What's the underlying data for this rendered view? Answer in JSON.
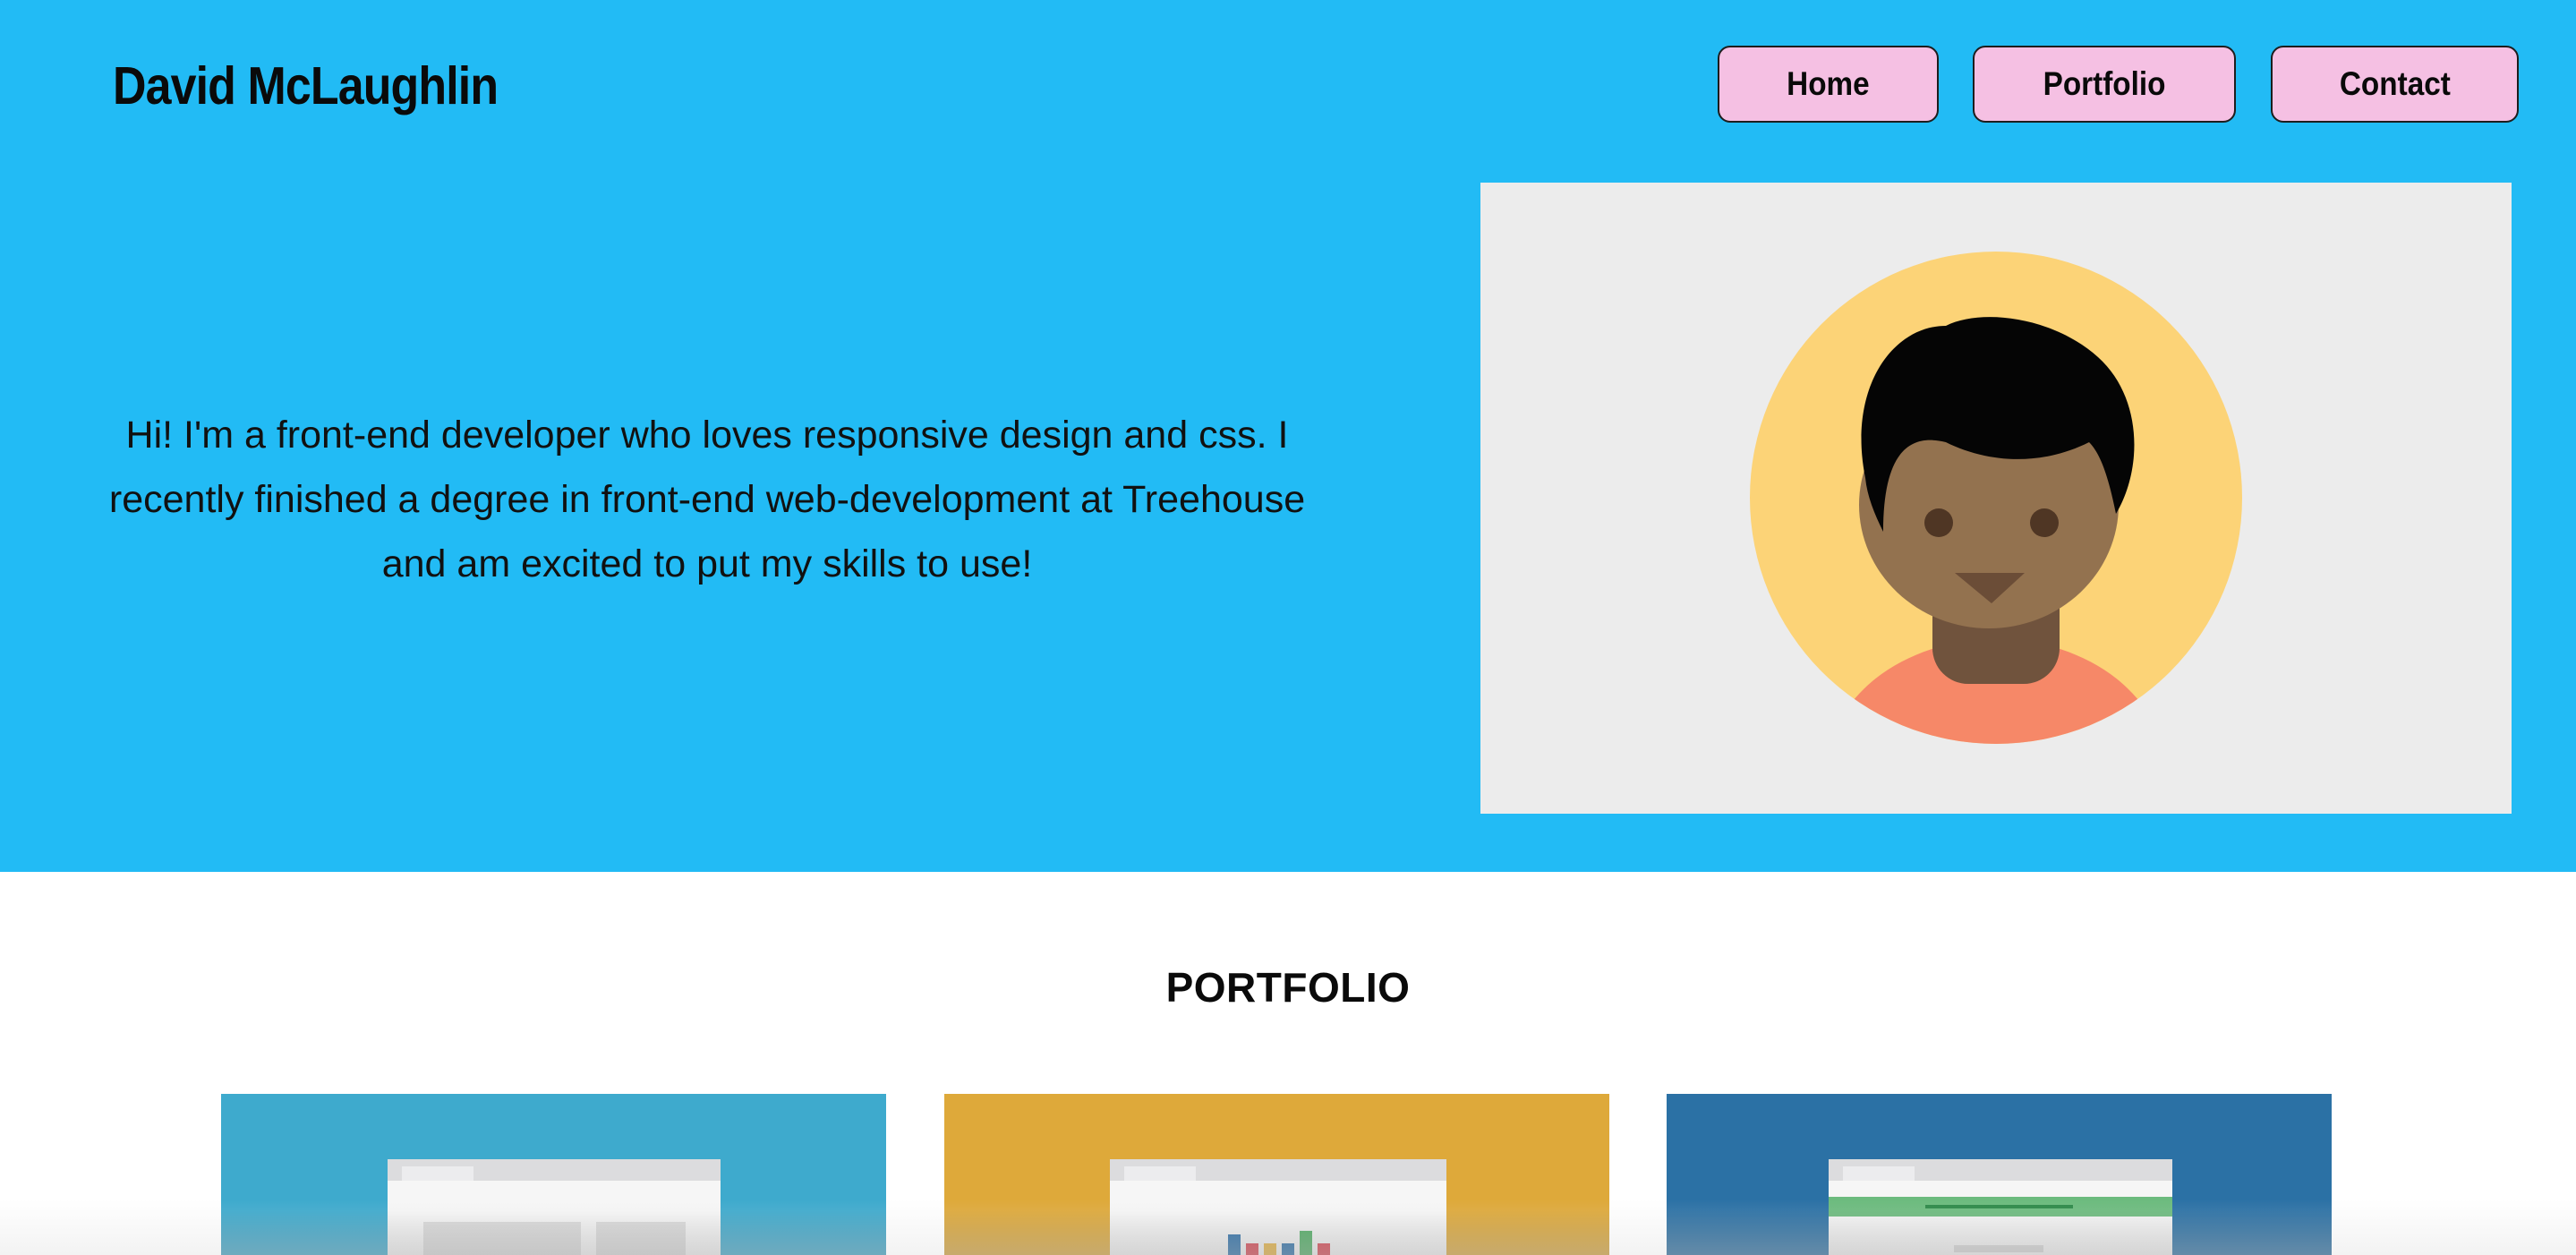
{
  "header": {
    "brand": "David McLaughlin",
    "nav": [
      {
        "label": "Home"
      },
      {
        "label": "Portfolio"
      },
      {
        "label": "Contact"
      }
    ]
  },
  "hero": {
    "intro": "Hi! I'm a front-end developer who loves responsive design and css. I recently finished a degree in front-end web-development at Treehouse and am excited to put my skills to use!",
    "avatar_icon": "person-avatar-icon"
  },
  "portfolio": {
    "title": "PORTFOLIO",
    "cards": [
      {
        "icon": "website-mockup-icon",
        "color": "#3eaacd"
      },
      {
        "icon": "bar-chart-mockup-icon",
        "color": "#dea93a"
      },
      {
        "icon": "form-mockup-icon",
        "color": "#2b71a5"
      }
    ]
  },
  "colors": {
    "hero_bg": "#22bbf5",
    "nav_button_bg": "#f5c0e3",
    "avatar_card_bg": "#ececec"
  }
}
